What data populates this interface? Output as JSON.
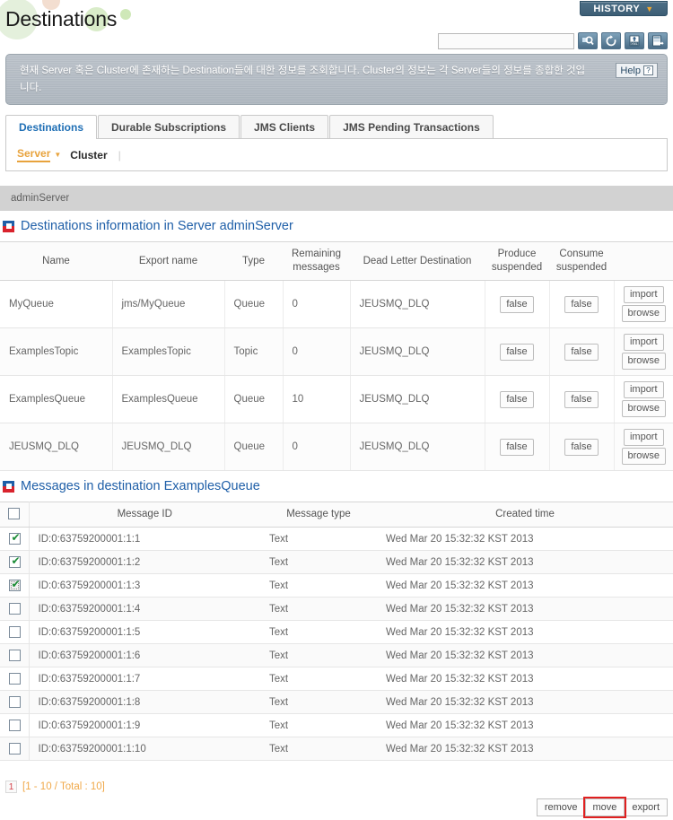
{
  "header": {
    "title": "Destinations",
    "history_label": "HISTORY",
    "history_caret": "▼",
    "search_value": "",
    "search_placeholder": "",
    "icons": [
      {
        "name": "search-icon",
        "label": "search"
      },
      {
        "name": "refresh-icon",
        "label": "refresh"
      },
      {
        "name": "export-xml-icon",
        "label": "XML"
      },
      {
        "name": "export-excel-icon",
        "label": "export"
      }
    ]
  },
  "description": {
    "text": "현재 Server 혹은 Cluster에 존재하는 Destination들에 대한 정보를 조회합니다. Cluster의 정보는 각 Server들의 정보를 종합한 것입니다.",
    "help_label": "Help",
    "help_mark": "?"
  },
  "tabs": [
    {
      "label": "Destinations",
      "active": true
    },
    {
      "label": "Durable Subscriptions",
      "active": false
    },
    {
      "label": "JMS Clients",
      "active": false
    },
    {
      "label": "JMS Pending Transactions",
      "active": false
    }
  ],
  "subnav": {
    "server_label": "Server",
    "caret": "▼",
    "cluster_label": "Cluster",
    "separator": "|"
  },
  "server_bar": {
    "name": "adminServer"
  },
  "destinations_section": {
    "title": "Destinations information in Server adminServer",
    "columns": [
      "Name",
      "Export name",
      "Type",
      "Remaining messages",
      "Dead Letter Destination",
      "Produce suspended",
      "Consume suspended",
      ""
    ],
    "columns_wrapped": [
      {
        "line1": "Name",
        "line2": ""
      },
      {
        "line1": "Export name",
        "line2": ""
      },
      {
        "line1": "Type",
        "line2": ""
      },
      {
        "line1": "Remaining",
        "line2": "messages"
      },
      {
        "line1": "Dead Letter Destination",
        "line2": ""
      },
      {
        "line1": "Produce",
        "line2": "suspended"
      },
      {
        "line1": "Consume",
        "line2": "suspended"
      },
      {
        "line1": "",
        "line2": ""
      }
    ],
    "rows": [
      {
        "name": "MyQueue",
        "export_name": "jms/MyQueue",
        "type": "Queue",
        "remaining": "0",
        "dlq": "JEUSMQ_DLQ",
        "produce_suspended": "false",
        "consume_suspended": "false",
        "import_label": "import",
        "browse_label": "browse"
      },
      {
        "name": "ExamplesTopic",
        "export_name": "ExamplesTopic",
        "type": "Topic",
        "remaining": "0",
        "dlq": "JEUSMQ_DLQ",
        "produce_suspended": "false",
        "consume_suspended": "false",
        "import_label": "import",
        "browse_label": "browse"
      },
      {
        "name": "ExamplesQueue",
        "export_name": "ExamplesQueue",
        "type": "Queue",
        "remaining": "10",
        "dlq": "JEUSMQ_DLQ",
        "produce_suspended": "false",
        "consume_suspended": "false",
        "import_label": "import",
        "browse_label": "browse"
      },
      {
        "name": "JEUSMQ_DLQ",
        "export_name": "JEUSMQ_DLQ",
        "type": "Queue",
        "remaining": "0",
        "dlq": "JEUSMQ_DLQ",
        "produce_suspended": "false",
        "consume_suspended": "false",
        "import_label": "import",
        "browse_label": "browse"
      }
    ]
  },
  "messages_section": {
    "title": "Messages in destination ExamplesQueue",
    "columns": [
      "",
      "Message ID",
      "Message type",
      "Created time"
    ],
    "select_all_checked": false,
    "rows": [
      {
        "checked": true,
        "focused": false,
        "id": "ID:0:63759200001:1:1",
        "type": "Text",
        "created": "Wed Mar 20 15:32:32 KST 2013"
      },
      {
        "checked": true,
        "focused": false,
        "id": "ID:0:63759200001:1:2",
        "type": "Text",
        "created": "Wed Mar 20 15:32:32 KST 2013"
      },
      {
        "checked": true,
        "focused": true,
        "id": "ID:0:63759200001:1:3",
        "type": "Text",
        "created": "Wed Mar 20 15:32:32 KST 2013"
      },
      {
        "checked": false,
        "focused": false,
        "id": "ID:0:63759200001:1:4",
        "type": "Text",
        "created": "Wed Mar 20 15:32:32 KST 2013"
      },
      {
        "checked": false,
        "focused": false,
        "id": "ID:0:63759200001:1:5",
        "type": "Text",
        "created": "Wed Mar 20 15:32:32 KST 2013"
      },
      {
        "checked": false,
        "focused": false,
        "id": "ID:0:63759200001:1:6",
        "type": "Text",
        "created": "Wed Mar 20 15:32:32 KST 2013"
      },
      {
        "checked": false,
        "focused": false,
        "id": "ID:0:63759200001:1:7",
        "type": "Text",
        "created": "Wed Mar 20 15:32:32 KST 2013"
      },
      {
        "checked": false,
        "focused": false,
        "id": "ID:0:63759200001:1:8",
        "type": "Text",
        "created": "Wed Mar 20 15:32:32 KST 2013"
      },
      {
        "checked": false,
        "focused": false,
        "id": "ID:0:63759200001:1:9",
        "type": "Text",
        "created": "Wed Mar 20 15:32:32 KST 2013"
      },
      {
        "checked": false,
        "focused": false,
        "id": "ID:0:63759200001:1:10",
        "type": "Text",
        "created": "Wed Mar 20 15:32:32 KST 2013"
      }
    ]
  },
  "pagination": {
    "current_page": "1",
    "info": "[1 - 10 / Total : 10]"
  },
  "footer_buttons": [
    {
      "label": "remove",
      "highlighted": false
    },
    {
      "label": "move",
      "highlighted": true
    },
    {
      "label": "export",
      "highlighted": false
    }
  ],
  "colors": {
    "accent_blue": "#1f5fa8",
    "tab_active": "#1f6fb5",
    "orange": "#e8a33d",
    "pager_orange": "#f0a94a",
    "pager_red": "#d4414a",
    "highlight_red": "#e02020",
    "history_bg": "#3d5e75",
    "server_bar_bg": "#d2d2d2",
    "desc_bg": "#b0b8c0"
  }
}
